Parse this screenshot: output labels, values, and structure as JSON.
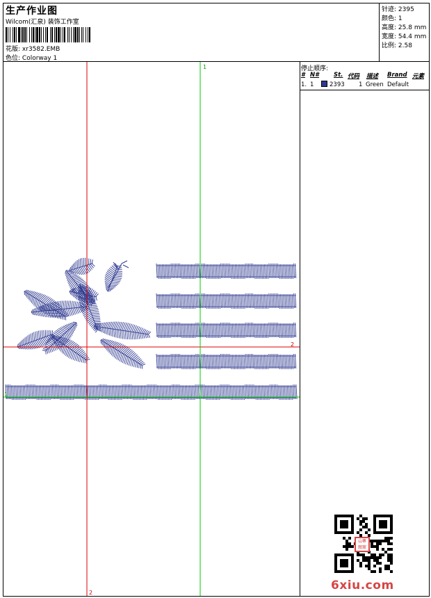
{
  "header": {
    "title": "生产作业图",
    "subtitle": "Wilcom(汇泉) 装饰工作室",
    "design_label": "花版:",
    "design_value": "xr3582.EMB",
    "colorway_label": "色位:",
    "colorway_value": "Colorway 1"
  },
  "stats": [
    {
      "label": "针迹:",
      "value": "2395"
    },
    {
      "label": "颜色:",
      "value": "1"
    },
    {
      "label": "高度:",
      "value": "25.8 mm"
    },
    {
      "label": "宽度:",
      "value": "54.4 mm"
    },
    {
      "label": "比例:",
      "value": "2.58"
    }
  ],
  "stop_sequence": {
    "title": "停止顺序:",
    "headers": [
      "#",
      "N#",
      "St.",
      "代码",
      "描述",
      "Brand",
      "元素"
    ],
    "row": {
      "index": "1.",
      "needle": "1",
      "stitches": "2393",
      "code": "1",
      "description": "Green",
      "brand": "Default"
    }
  },
  "guides": {
    "red_top": "2",
    "red_bottom": "2",
    "green_top": "1",
    "green_left": "1",
    "red_right": "2"
  },
  "colors": {
    "thread": "#2f3a8f",
    "guide_red": "#dd0000",
    "guide_green": "#00cc00",
    "watermark": "#d64545"
  },
  "watermark": {
    "text": "6xiu.com",
    "stamp": "山寨图案"
  }
}
